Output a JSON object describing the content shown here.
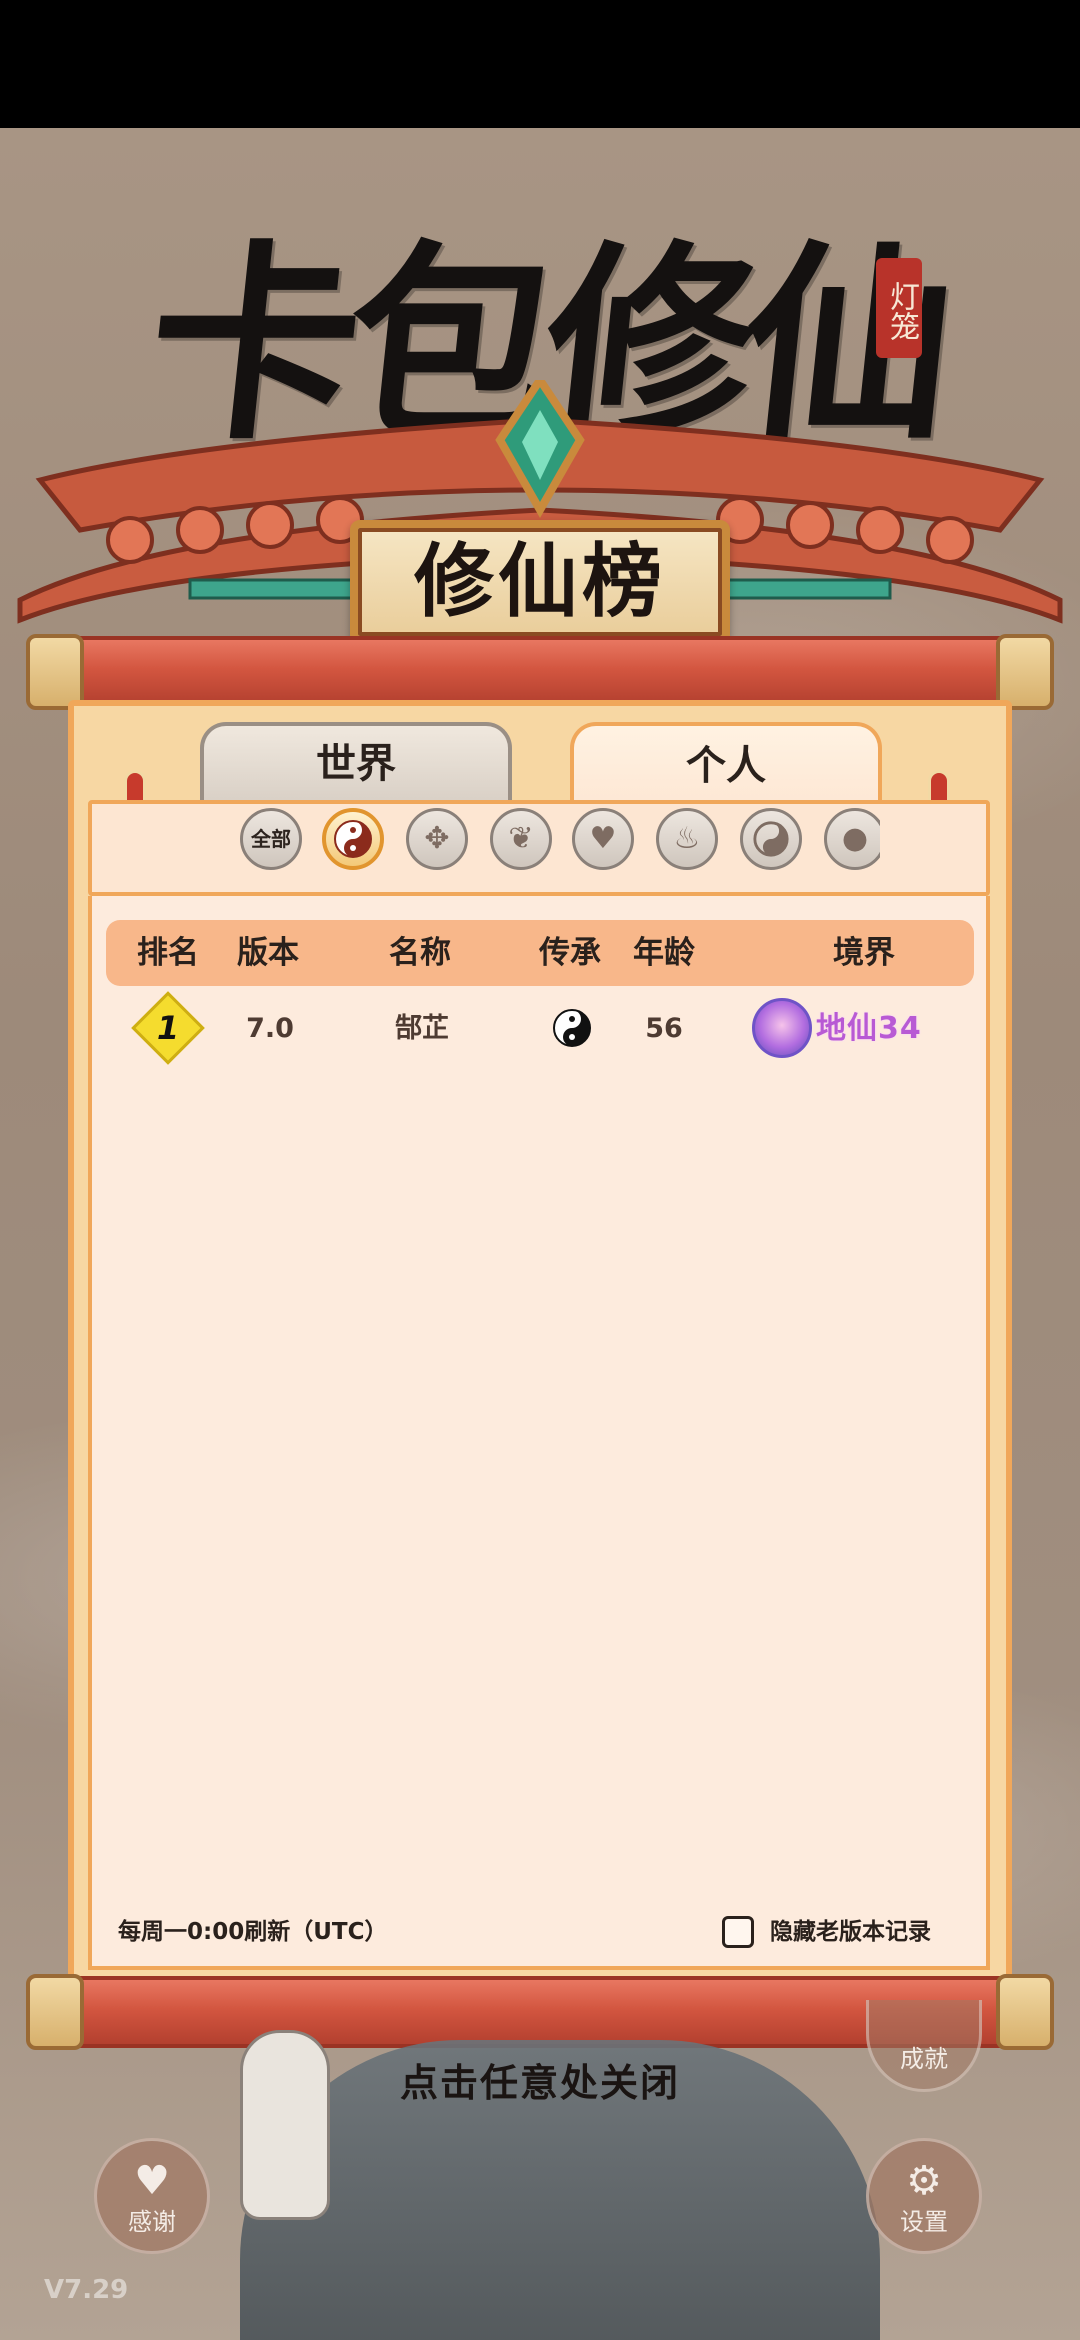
{
  "header": {
    "game_title": "卡包修仙",
    "title_seal": "灯笼",
    "plaque_title": "修仙榜"
  },
  "tabs": [
    {
      "label": "世界",
      "active": false
    },
    {
      "label": "个人",
      "active": true
    }
  ],
  "filters": {
    "all_label": "全部",
    "icons": [
      "yin-yang-icon",
      "sword-emblem-icon",
      "open-book-icon",
      "heart-icon",
      "flame-icon",
      "spiral-yin-yang-icon",
      "partial-icon"
    ],
    "selected": "yin-yang-icon"
  },
  "table": {
    "headers": [
      "排名",
      "版本",
      "名称",
      "传承",
      "年龄",
      "境界"
    ],
    "rows": [
      {
        "rank": "1",
        "version": "7.0",
        "name": "郜芷",
        "inheritance_icon": "yin-yang-icon",
        "age": "56",
        "realm": "地仙34"
      }
    ]
  },
  "footer": {
    "refresh_note": "每周一0:00刷新（UTC）",
    "hide_old_label": "隐藏老版本记录",
    "hide_old_checked": false
  },
  "close_hint": "点击任意处关闭",
  "buttons": {
    "achievement": "成就",
    "thanks": "感谢",
    "settings": "设置"
  },
  "version": "V7.29",
  "colors": {
    "panel": "#f7d7a3",
    "panel_border": "#f0a75a",
    "table_bg": "#fdebdd",
    "header_row": "#f8b78a",
    "roller": "#d35640",
    "realm_text": "#b85ad4"
  }
}
